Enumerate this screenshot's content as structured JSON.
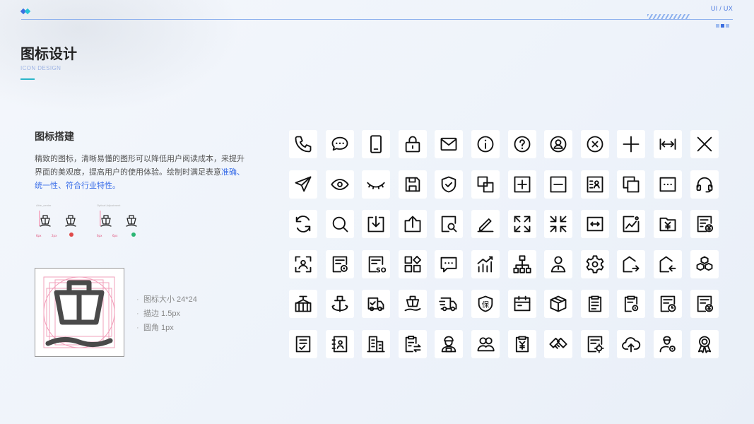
{
  "header": {
    "tag": "UI / UX"
  },
  "page": {
    "title": "图标设计",
    "subtitle": "ICON DESIGN"
  },
  "section": {
    "title": "图标搭建",
    "desc_plain": "精致的图标，清晰易懂的图形可以降低用户阅读成本，来提升界面的美观度，提高用户的使用体验。绘制时满足表意",
    "desc_highlight": "准确、统一性、符合行业特性。"
  },
  "specs": [
    "图标大小  24*24",
    "描边  1.5px",
    "圆角  1px"
  ],
  "samples": {
    "label_left": "Able_center",
    "label_right": "Optical Adjustment",
    "px_labels": [
      "6px",
      "2px",
      "6px",
      "6px"
    ]
  },
  "icons": [
    "phone-icon",
    "chat-bubbles-icon",
    "mobile-icon",
    "lock-icon",
    "mail-icon",
    "info-icon",
    "help-icon",
    "user-circle-icon",
    "close-circle-icon",
    "plus-icon",
    "width-icon",
    "close-icon",
    "send-icon",
    "eye-icon",
    "eye-closed-icon",
    "save-icon",
    "shield-check-icon",
    "link-squares-icon",
    "plus-square-icon",
    "minus-square-icon",
    "id-card-icon",
    "copy-icon",
    "more-square-icon",
    "headset-icon",
    "refresh-icon",
    "search-icon",
    "download-icon",
    "share-icon",
    "doc-search-icon",
    "edit-icon",
    "expand-icon",
    "collapse-icon",
    "arrows-horizontal-icon",
    "line-chart-icon",
    "folder-yen-icon",
    "invoice-yen-icon",
    "face-scan-icon",
    "doc-settings-icon",
    "doc-so-icon",
    "apps-icon",
    "message-more-icon",
    "bar-chart-icon",
    "org-chart-icon",
    "user-tie-icon",
    "gear-icon",
    "home-arrow-right-icon",
    "home-arrow-left-icon",
    "boxes-icon",
    "container-crane-icon",
    "port-anchor-icon",
    "truck-check-icon",
    "ship-icon",
    "delivery-truck-icon",
    "insurance-shield-icon",
    "ticket-icon",
    "box-icon",
    "clipboard-list-icon",
    "clipboard-settings-icon",
    "doc-clock-icon",
    "doc-yen-icon",
    "doc-check-icon",
    "contact-card-icon",
    "building-icon",
    "doc-exchange-icon",
    "driver-icon",
    "team-icon",
    "clipboard-yen-icon",
    "handshake-icon",
    "doc-target-icon",
    "cloud-upload-icon",
    "user-settings-icon",
    "award-icon"
  ]
}
